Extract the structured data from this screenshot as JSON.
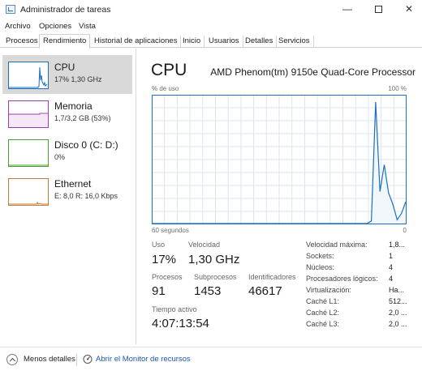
{
  "window": {
    "title": "Administrador de tareas",
    "minimize": "—",
    "close": "✕"
  },
  "menu": [
    "Archivo",
    "Opciones",
    "Vista"
  ],
  "tabs": [
    "Procesos",
    "Rendimiento",
    "Historial de aplicaciones",
    "Inicio",
    "Usuarios",
    "Detalles",
    "Servicios"
  ],
  "active_tab": "Rendimiento",
  "sidebar": {
    "items": [
      {
        "name": "CPU",
        "detail": "17% 1,30 GHz",
        "color": "#1a6fc1"
      },
      {
        "name": "Memoria",
        "detail": "1,7/3,2 GB (53%)",
        "color": "#9b3fb0"
      },
      {
        "name": "Disco 0 (C: D:)",
        "detail": "0%",
        "color": "#4aa02c"
      },
      {
        "name": "Ethernet",
        "detail": "E: 8,0  R: 16,0 Kbps",
        "color": "#c87a3a"
      }
    ]
  },
  "main": {
    "title": "CPU",
    "model": "AMD Phenom(tm) 9150e Quad-Core Processor",
    "graph": {
      "y_label": "% de uso",
      "y_max_label": "100 %",
      "x_label": "60 segundos",
      "x_min_label": "0",
      "series_color": "#1a6fc1",
      "usage_samples_percent": [
        0,
        0,
        0,
        0,
        0,
        0,
        0,
        0,
        0,
        0,
        0,
        0,
        0,
        0,
        0,
        0,
        0,
        0,
        0,
        0,
        0,
        0,
        0,
        0,
        0,
        0,
        0,
        0,
        0,
        0,
        0,
        0,
        0,
        0,
        0,
        0,
        0,
        0,
        0,
        0,
        0,
        0,
        0,
        0,
        0,
        0,
        0,
        0,
        0,
        0,
        0,
        2,
        95,
        25,
        46,
        24,
        15,
        3,
        8,
        17
      ]
    },
    "stats": {
      "uso_label": "Uso",
      "uso_value": "17%",
      "velocidad_label": "Velocidad",
      "velocidad_value": "1,30 GHz",
      "procesos_label": "Procesos",
      "procesos_value": "91",
      "subprocesos_label": "Subprocesos",
      "subprocesos_value": "1453",
      "identificadores_label": "Identificadores",
      "identificadores_value": "46617",
      "tiempo_label": "Tiempo activo",
      "tiempo_value": "4:07:13:54"
    },
    "specs": [
      {
        "label": "Velocidad máxima:",
        "value": "1,8..."
      },
      {
        "label": "Sockets:",
        "value": "1"
      },
      {
        "label": "Núcleos:",
        "value": "4"
      },
      {
        "label": "Procesadores lógicos:",
        "value": "4"
      },
      {
        "label": "Virtualización:",
        "value": "Ha..."
      },
      {
        "label": "Caché L1:",
        "value": "512..."
      },
      {
        "label": "Caché L2:",
        "value": "2,0 ..."
      },
      {
        "label": "Caché L3:",
        "value": "2,0 ..."
      }
    ]
  },
  "footer": {
    "less_details": "Menos detalles",
    "resource_monitor": "Abrir el Monitor de recursos"
  }
}
